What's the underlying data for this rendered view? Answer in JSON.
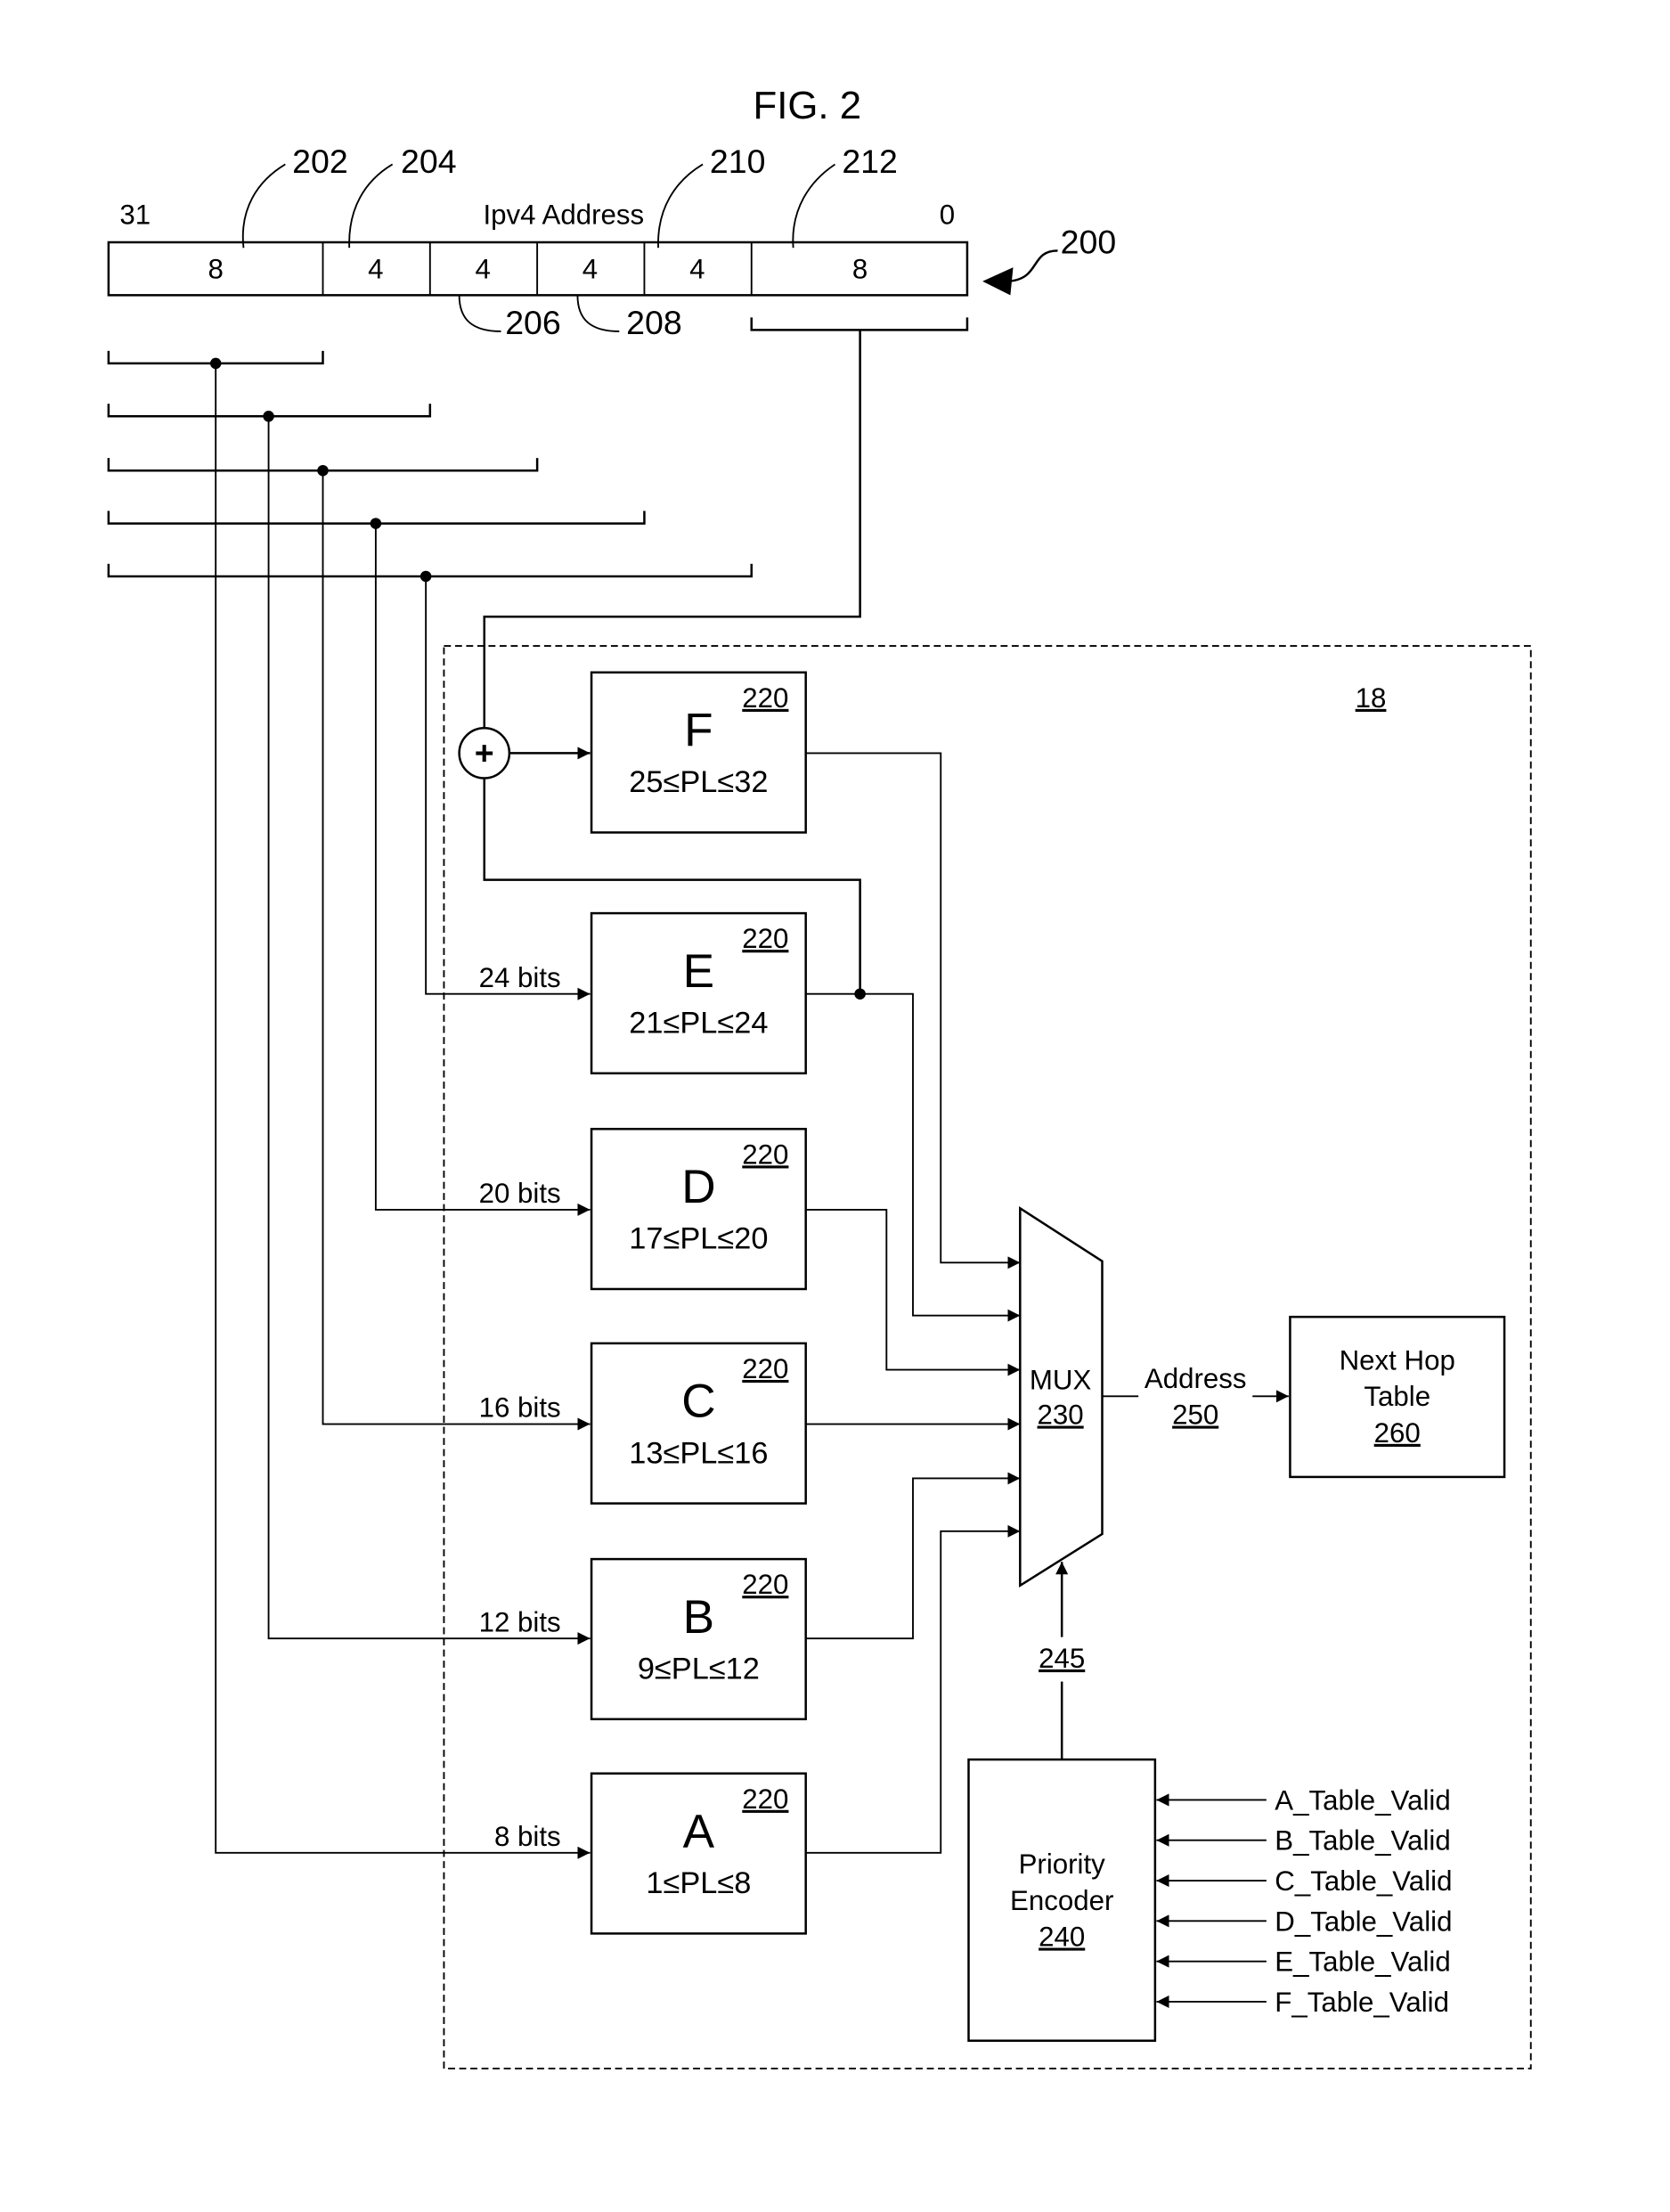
{
  "figure": {
    "title": "FIG. 2",
    "ref_figure": "200",
    "ref_system": "18"
  },
  "address": {
    "label": "Ipv4 Address",
    "msb": "31",
    "lsb": "0",
    "fields": [
      {
        "bits": "8",
        "ref": "202"
      },
      {
        "bits": "4",
        "ref": "204"
      },
      {
        "bits": "4",
        "ref": "206"
      },
      {
        "bits": "4",
        "ref": "208"
      },
      {
        "bits": "4",
        "ref": "210"
      },
      {
        "bits": "8",
        "ref": "212"
      }
    ]
  },
  "tables": [
    {
      "letter": "F",
      "range": "25≤PL≤32",
      "ref": "220",
      "input": ""
    },
    {
      "letter": "E",
      "range": "21≤PL≤24",
      "ref": "220",
      "input": "24 bits"
    },
    {
      "letter": "D",
      "range": "17≤PL≤20",
      "ref": "220",
      "input": "20 bits"
    },
    {
      "letter": "C",
      "range": "13≤PL≤16",
      "ref": "220",
      "input": "16 bits"
    },
    {
      "letter": "B",
      "range": "9≤PL≤12",
      "ref": "220",
      "input": "12 bits"
    },
    {
      "letter": "A",
      "range": "1≤PL≤8",
      "ref": "220",
      "input": "8 bits"
    }
  ],
  "adder": {
    "symbol": "+"
  },
  "mux": {
    "label": "MUX",
    "ref": "230"
  },
  "address_out": {
    "label": "Address",
    "ref": "250"
  },
  "next_hop": {
    "line1": "Next Hop",
    "line2": "Table",
    "ref": "260"
  },
  "select_signal": {
    "ref": "245"
  },
  "encoder": {
    "line1": "Priority",
    "line2": "Encoder",
    "ref": "240"
  },
  "valid_signals": [
    "A_Table_Valid",
    "B_Table_Valid",
    "C_Table_Valid",
    "D_Table_Valid",
    "E_Table_Valid",
    "F_Table_Valid"
  ]
}
